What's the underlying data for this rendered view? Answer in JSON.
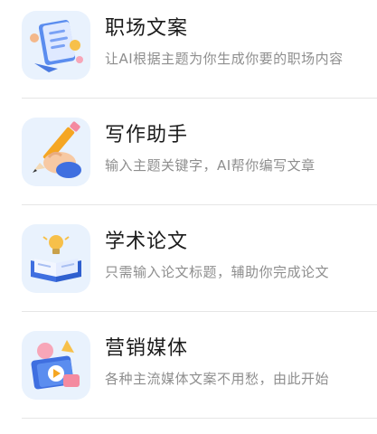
{
  "items": [
    {
      "title": "职场文案",
      "subtitle": "让AI根据主题为你生成你要的职场内容",
      "icon": "document-clipboard-icon"
    },
    {
      "title": "写作助手",
      "subtitle": "输入主题关键字，AI帮你编写文章",
      "icon": "hand-pencil-icon"
    },
    {
      "title": "学术论文",
      "subtitle": "只需输入论文标题，辅助你完成论文",
      "icon": "book-lightbulb-icon"
    },
    {
      "title": "营销媒体",
      "subtitle": "各种主流媒体文案不用愁，由此开始",
      "icon": "media-play-icon"
    }
  ],
  "colors": {
    "icon_bg": "#e9f2fd",
    "title": "#1b1b1b",
    "subtitle": "#8e8e8e",
    "divider": "#e6e6e6",
    "accent_blue": "#3b82f6",
    "accent_orange": "#f5a623"
  }
}
